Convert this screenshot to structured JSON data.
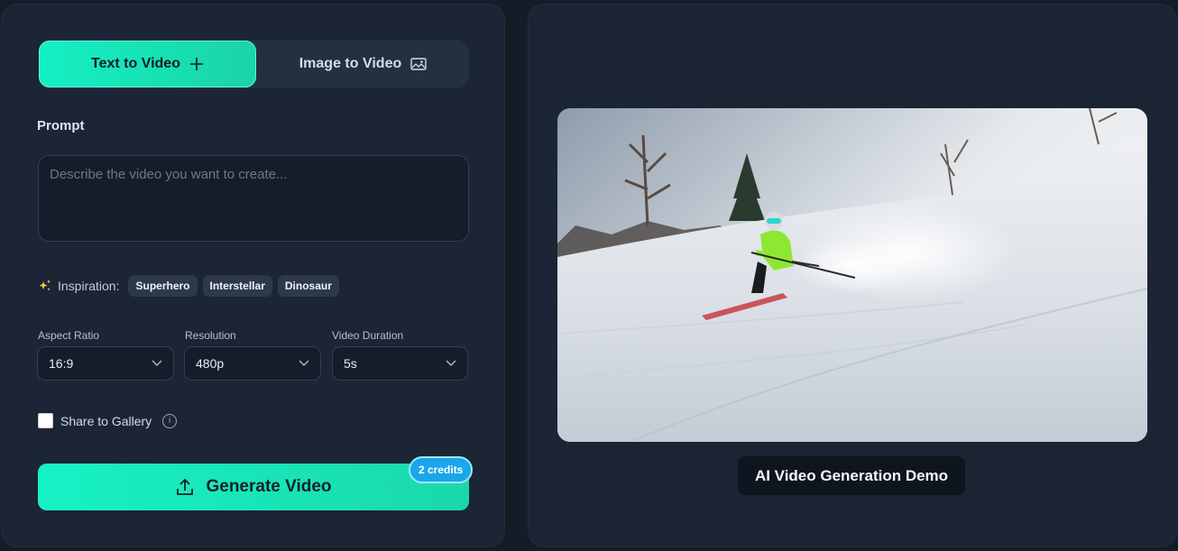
{
  "tabs": {
    "text_to_video": "Text to Video",
    "image_to_video": "Image to Video"
  },
  "prompt": {
    "label": "Prompt",
    "placeholder": "Describe the video you want to create..."
  },
  "inspiration": {
    "label": "Inspiration:",
    "chips": [
      "Superhero",
      "Interstellar",
      "Dinosaur"
    ]
  },
  "settings": {
    "aspect_ratio": {
      "label": "Aspect Ratio",
      "value": "16:9"
    },
    "resolution": {
      "label": "Resolution",
      "value": "480p"
    },
    "duration": {
      "label": "Video Duration",
      "value": "5s"
    }
  },
  "share": {
    "label": "Share to Gallery",
    "checked": false
  },
  "generate": {
    "label": "Generate Video",
    "credits": "2 credits"
  },
  "demo": {
    "caption": "AI Video Generation Demo"
  },
  "colors": {
    "accent": "#17f2c4",
    "credits_badge": "#1aa6ea",
    "background": "#141c27",
    "panel": "#1b2535"
  }
}
